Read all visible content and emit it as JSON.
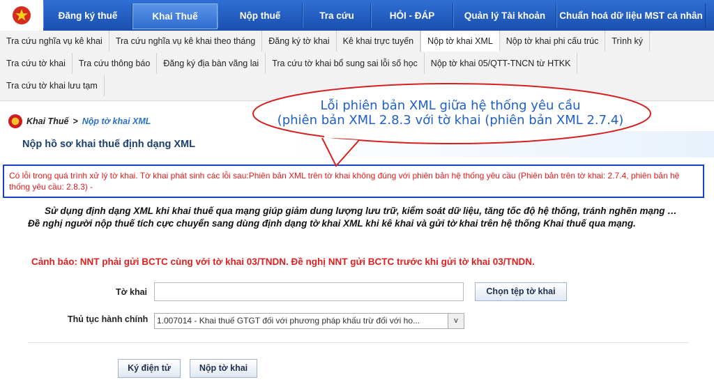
{
  "topnav": {
    "tabs": [
      {
        "label": "Đăng ký thuế"
      },
      {
        "label": "Khai Thuế"
      },
      {
        "label": "Nộp thuế"
      },
      {
        "label": "Tra cứu"
      },
      {
        "label": "HỎI - ĐÁP"
      },
      {
        "label": "Quản lý Tài khoản"
      },
      {
        "label": "Chuẩn hoá dữ liệu MST cá nhân"
      }
    ],
    "active": "Khai Thuế"
  },
  "subnav": {
    "row1": [
      "Tra cứu nghĩa vụ kê khai",
      "Tra cứu nghĩa vụ kê khai theo tháng",
      "Đăng ký tờ khai",
      "Kê khai trực tuyến",
      "Nộp tờ khai XML",
      "Nộp tờ khai phi cấu trúc",
      "Trình ký"
    ],
    "row2": [
      "Tra cứu tờ khai",
      "Tra cứu thông báo",
      "Đăng ký địa bàn vãng lai",
      "Tra cứu tờ khai bổ sung sai lỗi số học",
      "Nộp tờ khai 05/QTT-TNCN từ HTKK"
    ],
    "row3": [
      "Tra cứu tờ khai lưu tạm"
    ],
    "active": "Nộp tờ khai XML"
  },
  "breadcrumb": {
    "home": "Khai Thuế",
    "separator": " > ",
    "current": "Nộp tờ khai XML"
  },
  "annotation": {
    "line1": "Lỗi phiên bản XML giữa hệ thống yêu cầu",
    "line2": "(phiên bản XML 2.8.3 với tờ khai (phiên bản XML 2.7.4)",
    "color": "#d62020"
  },
  "panel": {
    "title": "Nộp hồ sơ khai thuế định dạng XML"
  },
  "error": {
    "text": "Có lỗi trong quá trình xử lý tờ khai. Tờ khai phát sinh các lỗi sau:Phiên bản XML trên tờ khai không đúng với phiên bản hệ thống yêu cầu (Phiên bản trên tờ khai: 2.7.4, phiên bản hệ thống yêu cầu: 2.8.3) -"
  },
  "info": {
    "text": "Sử dụng định dạng XML khi khai thuế qua mạng giúp giảm dung lượng lưu trữ, kiểm soát dữ liệu, tăng tốc độ hệ thống, tránh nghẽn mạng … Đề nghị người nộp thuế tích cực chuyển sang dùng định dạng tờ khai XML khi kê khai và gửi tờ khai trên hệ thống Khai thuế qua mạng."
  },
  "warning": {
    "text": "Cảnh báo: NNT phải gửi BCTC cùng với tờ khai 03/TNDN. Đề nghị NNT gửi BCTC trước khi gửi tờ khai 03/TNDN."
  },
  "form": {
    "to_khai_label": "Tờ khai",
    "file_value": "",
    "choose_file_label": "Chọn tệp tờ khai",
    "thu_tuc_label": "Thủ tục hành chính",
    "thu_tuc_value": "1.007014 - Khai thuế GTGT đối với phương pháp khấu trừ đối với ho...",
    "select_arrow": "v",
    "sign_label": "Ký điện tử",
    "submit_label": "Nộp tờ khai"
  },
  "colors": {
    "nav": "#1b4fae",
    "error_border": "#1a3fcc",
    "error_text": "#e11c1c",
    "annotation_text": "#1f5fc9"
  }
}
